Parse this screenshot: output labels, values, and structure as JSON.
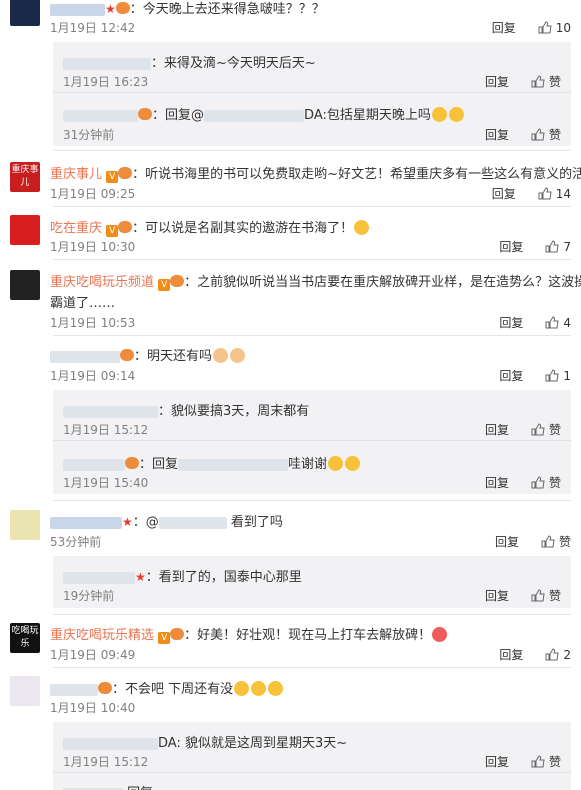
{
  "actions": {
    "reply": "回复",
    "like": "赞"
  },
  "comments": [
    {
      "text": "今天晚上去还来得急啵哇？？？",
      "time": "1月19日 12:42",
      "likes": "10"
    },
    {
      "text": "来得及滴~今天明天后天~",
      "time": "1月19日 16:23"
    },
    {
      "prefix": "回复@",
      "text": "DA:包括星期天晚上吗",
      "time": "31分钟前"
    },
    {
      "name": "重庆事儿",
      "text": "听说书海里的书可以免费取走哟~好文艺！希望重庆多有一些这么有意义的活动~",
      "time": "1月19日 09:25",
      "likes": "14",
      "avatar_text": "重庆事儿"
    },
    {
      "name": "吃在重庆",
      "text": "可以说是名副其实的遨游在书海了！",
      "time": "1月19日 10:30",
      "likes": "7"
    },
    {
      "name": "重庆吃喝玩乐频道",
      "text": "之前貌似听说当当书店要在重庆解放碑开业样，是在造势么？这波操作",
      "text2": "霸道了……",
      "time": "1月19日 10:53",
      "likes": "4"
    },
    {
      "text": "明天还有吗",
      "time": "1月19日 09:14",
      "likes": "1"
    },
    {
      "text": "貌似要搞3天，周末都有",
      "time": "1月19日 15:12"
    },
    {
      "prefix": "回复",
      "text": "哇谢谢",
      "time": "1月19日 15:40"
    },
    {
      "prefix": "@",
      "text": "看到了吗",
      "time": "53分钟前"
    },
    {
      "text": "看到了的，国泰中心那里",
      "time": "19分钟前"
    },
    {
      "name": "重庆吃喝玩乐精选",
      "text": "好美！好壮观！现在马上打车去解放碑！",
      "time": "1月19日 09:49",
      "likes": "2",
      "avatar_text": "吃喝玩乐"
    },
    {
      "text": "不会吧 下周还有没",
      "time": "1月19日 10:40"
    },
    {
      "text": "DA: 貌似就是这周到星期天3天~",
      "time": "1月19日 15:12"
    },
    {
      "prefix": "回复",
      "text": "",
      "time": ""
    }
  ]
}
